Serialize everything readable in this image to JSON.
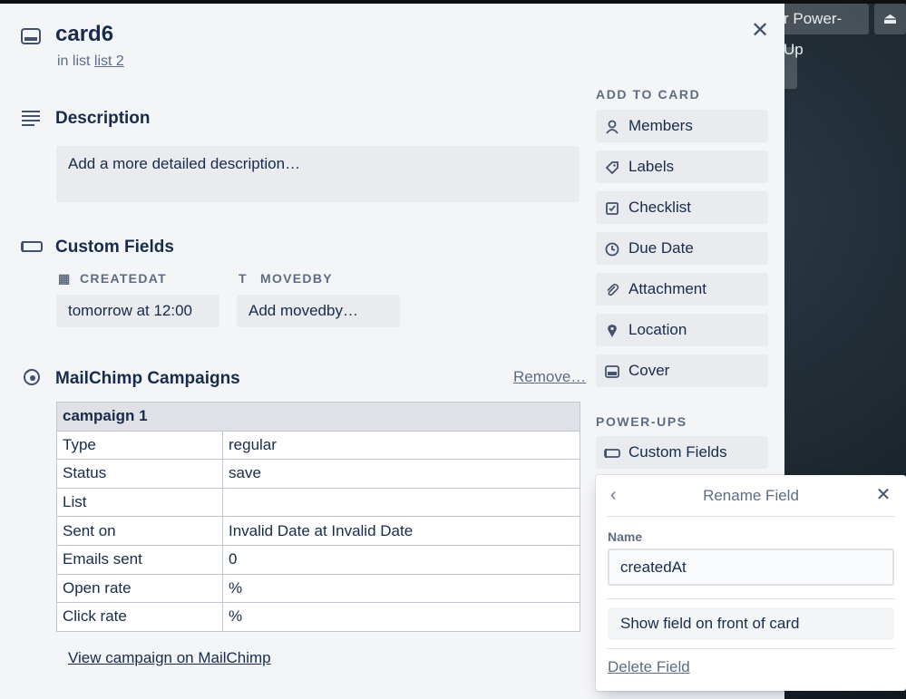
{
  "top_bar": {
    "powerup_label": "r Power-Up",
    "eject_glyph": "⏏"
  },
  "card": {
    "title": "card6",
    "in_list_prefix": "in list",
    "list_name": "list 2"
  },
  "description": {
    "title": "Description",
    "placeholder": "Add a more detailed description…"
  },
  "custom_fields": {
    "title": "Custom Fields",
    "fields": [
      {
        "label": "CREATEDAT",
        "icon": "calendar-icon",
        "value": "tomorrow at 12:00"
      },
      {
        "label": "MOVEDBY",
        "icon": "text-icon",
        "value": "Add movedby…"
      }
    ]
  },
  "mailchimp": {
    "title": "MailChimp Campaigns",
    "remove_label": "Remove…",
    "campaign_name": "campaign 1",
    "rows": [
      {
        "key": "Type",
        "value": "regular"
      },
      {
        "key": "Status",
        "value": "save"
      },
      {
        "key": "List",
        "value": ""
      },
      {
        "key": "Sent on",
        "value": "Invalid Date at Invalid Date"
      },
      {
        "key": "Emails sent",
        "value": "0"
      },
      {
        "key": "Open rate",
        "value": "%"
      },
      {
        "key": "Click rate",
        "value": "%"
      }
    ],
    "view_link": "View campaign on MailChimp"
  },
  "sidebar": {
    "add_to_card_heading": "ADD TO CARD",
    "add_items": [
      {
        "label": "Members",
        "icon": "person-icon"
      },
      {
        "label": "Labels",
        "icon": "label-icon"
      },
      {
        "label": "Checklist",
        "icon": "checklist-icon"
      },
      {
        "label": "Due Date",
        "icon": "clock-icon"
      },
      {
        "label": "Attachment",
        "icon": "paperclip-icon"
      },
      {
        "label": "Location",
        "icon": "pin-icon"
      },
      {
        "label": "Cover",
        "icon": "cover-icon"
      }
    ],
    "powerups_heading": "POWER-UPS",
    "powerup_items": [
      {
        "label": "Custom Fields",
        "icon": "custom-fields-icon"
      }
    ]
  },
  "rename_popover": {
    "title": "Rename Field",
    "name_label": "Name",
    "name_value": "createdAt",
    "show_on_front_label": "Show field on front of card",
    "delete_label": "Delete Field"
  }
}
